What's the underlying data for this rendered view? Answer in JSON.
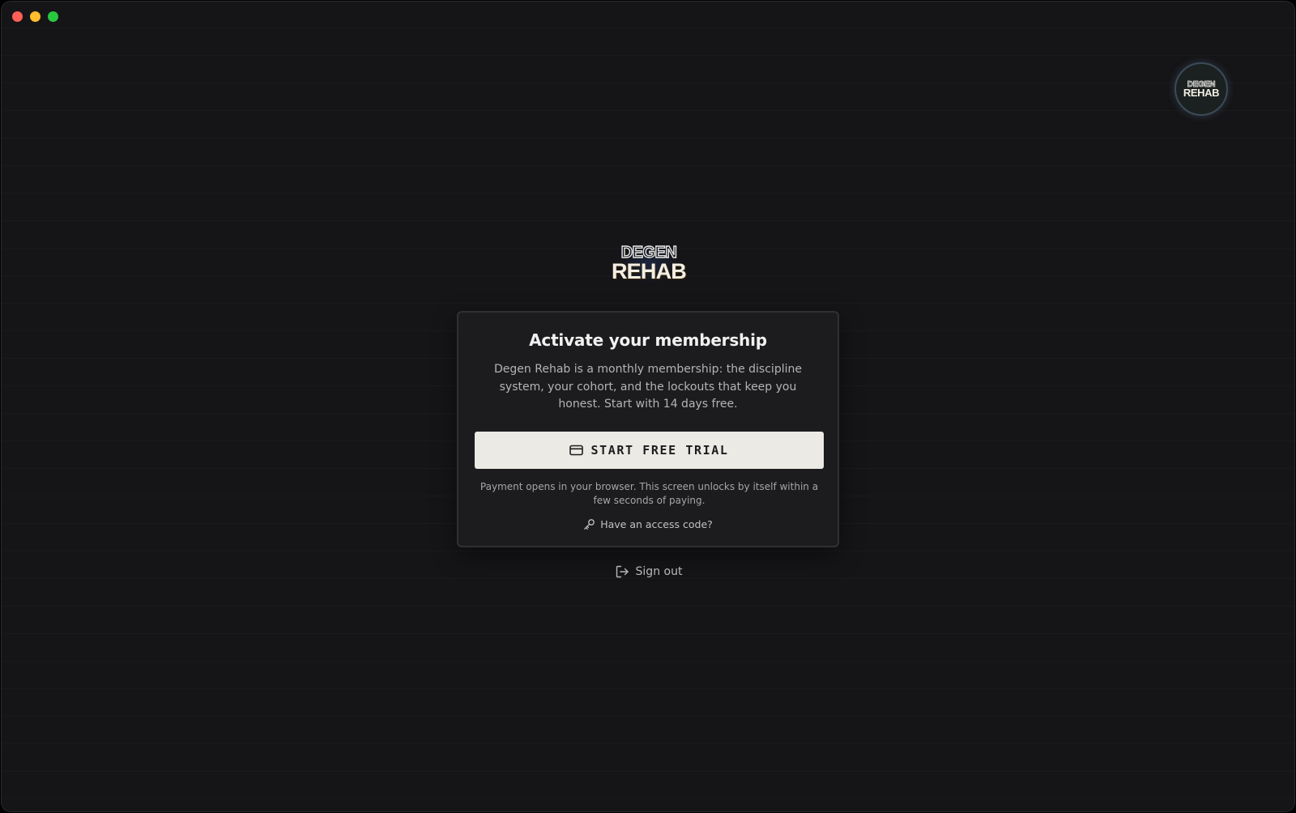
{
  "window": {
    "controls": [
      "close",
      "minimize",
      "maximize"
    ]
  },
  "header": {
    "avatar_logo": {
      "top": "DEGEN",
      "bottom": "REHAB"
    }
  },
  "brand": {
    "logo_top": "DEGEN",
    "logo_bottom": "REHAB"
  },
  "card": {
    "title": "Activate your membership",
    "description": "Degen Rehab is a monthly membership: the discipline system, your cohort, and the lockouts that keep you honest. Start with 14 days free.",
    "cta": {
      "label": "START FREE TRIAL",
      "icon": "credit-card-icon"
    },
    "note": "Payment opens in your browser. This screen unlocks by itself within a few seconds of paying.",
    "access_link": {
      "label": "Have an access code?",
      "icon": "key-icon"
    }
  },
  "footer": {
    "signout": {
      "label": "Sign out",
      "icon": "log-out-icon"
    }
  },
  "colors": {
    "background": "#151517",
    "card": "#1c1c1e",
    "card_border": "#303033",
    "button": "#ebeae4",
    "button_text": "#1d1d1f",
    "title_text": "#f1f1f1",
    "muted_text": "#b4b4b8"
  }
}
